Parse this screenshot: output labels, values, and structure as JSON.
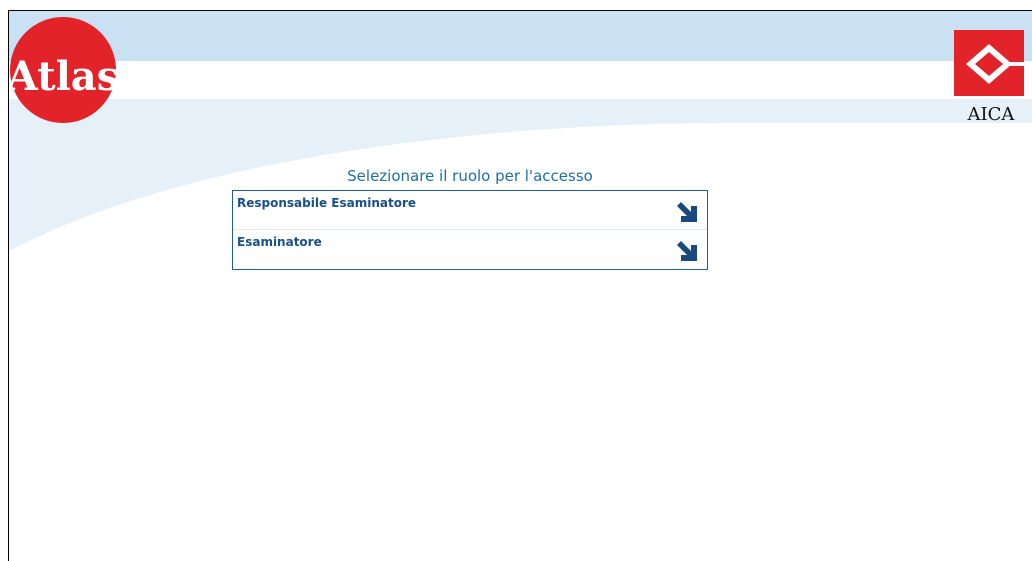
{
  "header": {
    "atlas_logo_text": "Atlas",
    "aica_logo_text": "AICA"
  },
  "role_selection": {
    "title": "Selezionare il ruolo per l'accesso",
    "roles": [
      {
        "label": "Responsabile Esaminatore",
        "icon": "arrow-down-right-icon"
      },
      {
        "label": "Esaminatore",
        "icon": "arrow-down-right-icon"
      }
    ]
  },
  "colors": {
    "accent": "#1f6ea8",
    "border": "#1f5e96",
    "header_band": "#c9e1f3",
    "logo_red": "#e3232a"
  }
}
